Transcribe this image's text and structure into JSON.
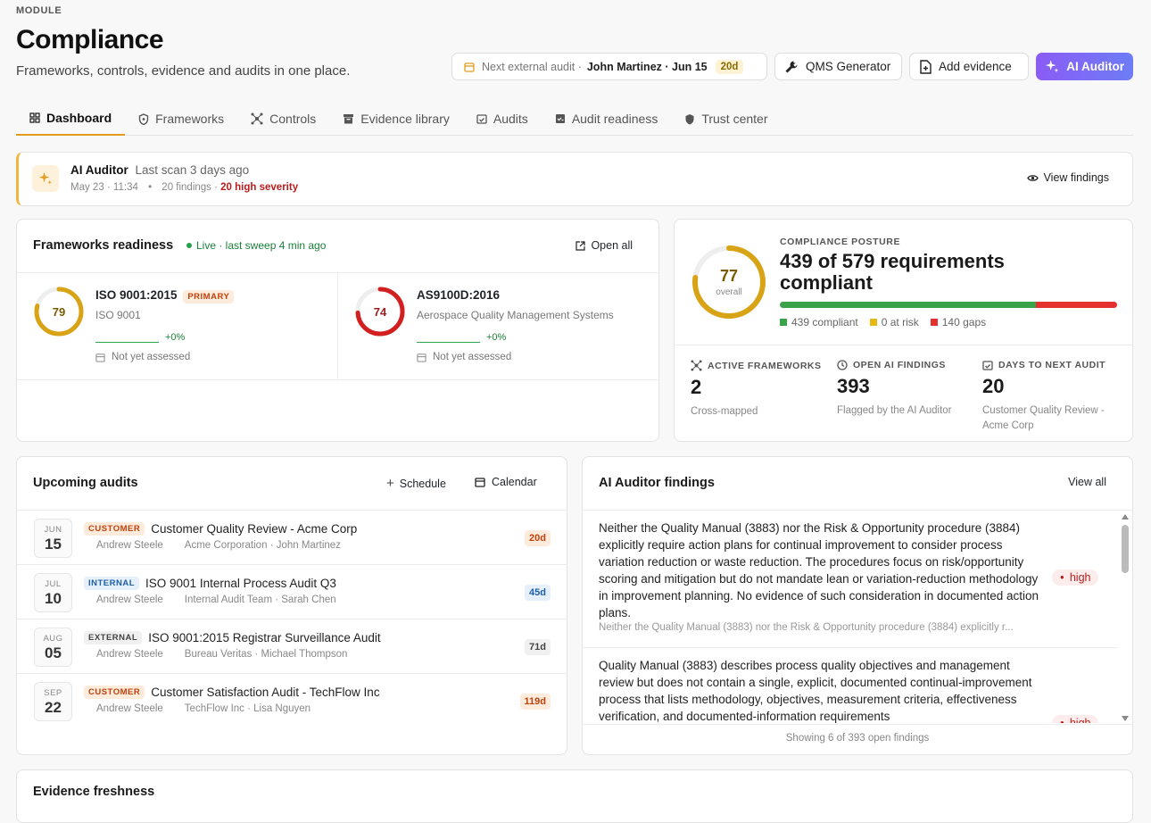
{
  "header": {
    "module": "MODULE",
    "title": "Compliance",
    "subtitle": "Frameworks, controls, evidence and audits in one place."
  },
  "toolbar": {
    "audit_prefix": "Next external audit ·",
    "audit_who": "John Martinez · Jun 15",
    "audit_days": "20d",
    "qms": "QMS Generator",
    "add_evidence": "Add evidence",
    "ai_auditor": "AI Auditor"
  },
  "tabs": [
    {
      "label": "Dashboard",
      "icon": "grid-icon"
    },
    {
      "label": "Frameworks",
      "icon": "shield-icon"
    },
    {
      "label": "Controls",
      "icon": "network-icon"
    },
    {
      "label": "Evidence library",
      "icon": "archive-icon"
    },
    {
      "label": "Audits",
      "icon": "calendar-check-icon"
    },
    {
      "label": "Audit readiness",
      "icon": "checklist-icon"
    },
    {
      "label": "Trust center",
      "icon": "shield-solid-icon"
    }
  ],
  "banner": {
    "title": "AI Auditor",
    "scan": "Last scan 3 days ago",
    "date": "May 23 · 11:34",
    "findings": "20 findings ·",
    "severity": "20 high severity",
    "action": "View findings"
  },
  "frameworks": {
    "title": "Frameworks readiness",
    "live": "Live · last sweep 4 min ago",
    "open_all": "Open all",
    "items": [
      {
        "score": 79,
        "name": "ISO 9001:2015",
        "badge": "PRIMARY",
        "desc": "ISO 9001",
        "delta": "+0%",
        "status": "Not yet assessed",
        "color": "#d9a316"
      },
      {
        "score": 74,
        "name": "AS9100D:2016",
        "badge": "",
        "desc": "Aerospace Quality Management Systems",
        "delta": "+0%",
        "status": "Not yet assessed",
        "color": "#d21f1f"
      }
    ]
  },
  "posture": {
    "score": 77,
    "score_label": "overall",
    "label": "COMPLIANCE POSTURE",
    "headline": "439 of 579 requirements compliant",
    "compliant": 439,
    "at_risk": 0,
    "gaps": 140,
    "legend": [
      "439 compliant",
      "0 at risk",
      "140 gaps"
    ],
    "stats": [
      {
        "label": "ACTIVE FRAMEWORKS",
        "value": "2",
        "note": "Cross-mapped"
      },
      {
        "label": "OPEN AI FINDINGS",
        "value": "393",
        "note": "Flagged by the AI Auditor"
      },
      {
        "label": "DAYS TO NEXT AUDIT",
        "value": "20",
        "note": "Customer Quality Review - Acme Corp"
      }
    ]
  },
  "audits": {
    "title": "Upcoming audits",
    "schedule": "Schedule",
    "calendar": "Calendar",
    "rows": [
      {
        "month": "JUN",
        "day": "15",
        "type": "CUSTOMER",
        "title": "Customer Quality Review - Acme Corp",
        "owner": "Andrew Steele",
        "org": "Acme Corporation · John Martinez",
        "days": "20d"
      },
      {
        "month": "JUL",
        "day": "10",
        "type": "INTERNAL",
        "title": "ISO 9001 Internal Process Audit Q3",
        "owner": "Andrew Steele",
        "org": "Internal Audit Team · Sarah Chen",
        "days": "45d"
      },
      {
        "month": "AUG",
        "day": "05",
        "type": "EXTERNAL",
        "title": "ISO 9001:2015 Registrar Surveillance Audit",
        "owner": "Andrew Steele",
        "org": "Bureau Veritas · Michael Thompson",
        "days": "71d"
      },
      {
        "month": "SEP",
        "day": "22",
        "type": "CUSTOMER",
        "title": "Customer Satisfaction Audit - TechFlow Inc",
        "owner": "Andrew Steele",
        "org": "TechFlow Inc · Lisa Nguyen",
        "days": "119d"
      }
    ]
  },
  "findings": {
    "title": "AI Auditor findings",
    "view_all": "View all",
    "footer": "Showing 6 of 393 open findings",
    "items": [
      {
        "text": "Neither the Quality Manual (3883) nor the Risk & Opportunity procedure (3884) explicitly require action plans for continual improvement to consider process variation reduction or waste reduction. The procedures focus on risk/opportunity scoring and mitigation but do not mandate lean or variation-reduction methodology in improvement planning. No evidence of such consideration in documented action plans.",
        "snippet": "Neither the Quality Manual (3883) nor the Risk & Opportunity procedure (3884) explicitly r...",
        "severity": "high"
      },
      {
        "text": "Quality Manual (3883) describes process quality objectives and management review but does not contain a single, explicit, documented continual-improvement process that lists methodology, objectives, measurement criteria, effectiveness verification, and documented-information requirements",
        "severity": "high"
      }
    ]
  },
  "evidence": {
    "title": "Evidence freshness"
  }
}
